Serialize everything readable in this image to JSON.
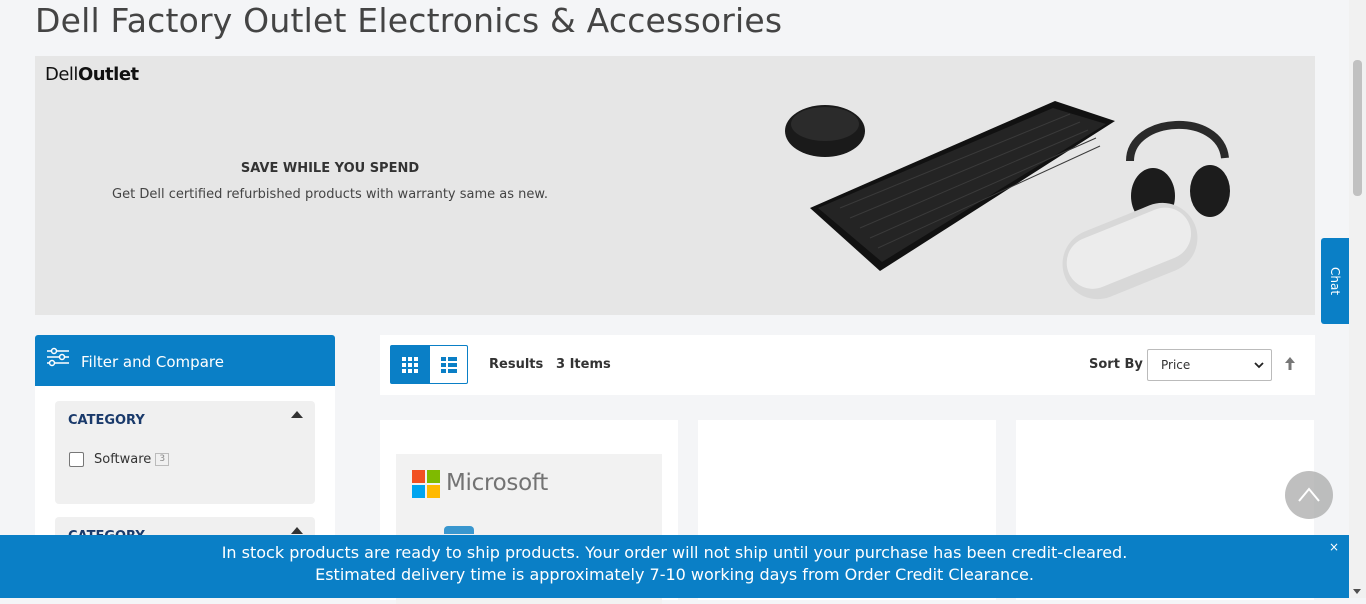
{
  "page": {
    "title": "Dell Factory Outlet Electronics & Accessories"
  },
  "banner": {
    "logo_prefix": "Dell",
    "logo_suffix": "Outlet",
    "heading": "SAVE WHILE YOU SPEND",
    "subtext": "Get Dell certified refurbished products with warranty same as new."
  },
  "chat": {
    "label": "Chat"
  },
  "filter": {
    "header": "Filter and Compare",
    "categories": [
      {
        "title": "CATEGORY",
        "options": [
          {
            "label": "Software",
            "count": "3"
          }
        ]
      },
      {
        "title": "CATEGORY"
      }
    ]
  },
  "toolbar": {
    "results_label": "Results",
    "results_count": "3 Items",
    "sort_label": "Sort By",
    "sort_value": "Price"
  },
  "products": [
    {
      "brand": "Microsoft"
    }
  ],
  "notice": {
    "line1": "In stock products are ready to ship products. Your order will not ship until your purchase has been credit-cleared.",
    "line2": "Estimated delivery time is approximately 7-10 working days from Order Credit Clearance.",
    "close": "×"
  },
  "colors": {
    "accent": "#0a7fc6",
    "banner_bg": "#e6e6e6",
    "page_bg": "#f4f5f7"
  }
}
